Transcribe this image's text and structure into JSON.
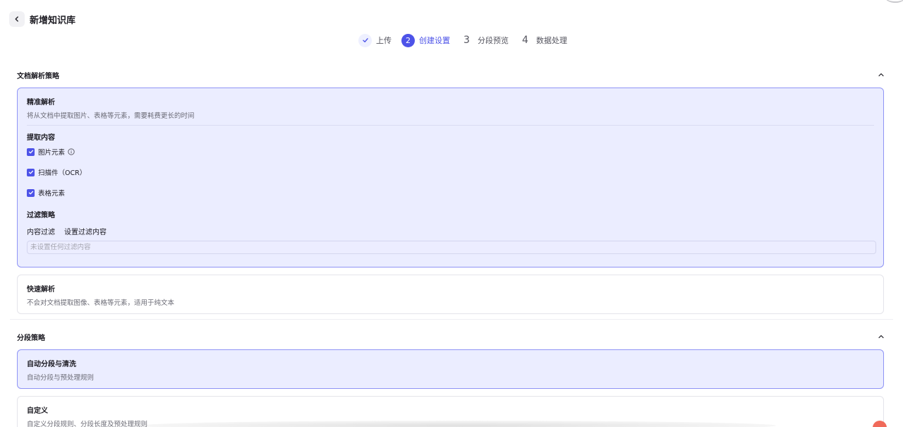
{
  "header": {
    "title": "新增知识库"
  },
  "steps": [
    {
      "index": "",
      "label": "上传",
      "state": "done"
    },
    {
      "index": "2",
      "label": "创建设置",
      "state": "active"
    },
    {
      "index": "3",
      "label": "分段预览",
      "state": "pending"
    },
    {
      "index": "4",
      "label": "数据处理",
      "state": "pending"
    }
  ],
  "parse_strategy": {
    "title": "文档解析策略",
    "precise": {
      "title": "精准解析",
      "desc": "将从文档中提取图片、表格等元素，需要耗费更长的时间",
      "extract_title": "提取内容",
      "options": [
        {
          "label": "图片元素",
          "checked": true,
          "info": true
        },
        {
          "label": "扫描件（OCR）",
          "checked": true,
          "info": false
        },
        {
          "label": "表格元素",
          "checked": true,
          "info": false
        }
      ],
      "filter_title": "过滤策略",
      "content_filter_label": "内容过滤",
      "set_filter_link": "设置过滤内容",
      "filter_placeholder": "未设置任何过滤内容"
    },
    "fast": {
      "title": "快速解析",
      "desc": "不会对文档提取图像、表格等元素，适用于纯文本"
    }
  },
  "segment_strategy": {
    "title": "分段策略",
    "auto": {
      "title": "自动分段与清洗",
      "desc": "自动分段与预处理规则"
    },
    "custom": {
      "title": "自定义",
      "desc": "自定义分段规则、分段长度及预处理规则"
    }
  },
  "colors": {
    "accent": "#4d53e8",
    "selected_bg": "#ebedff",
    "selected_border": "#8f94f5"
  }
}
